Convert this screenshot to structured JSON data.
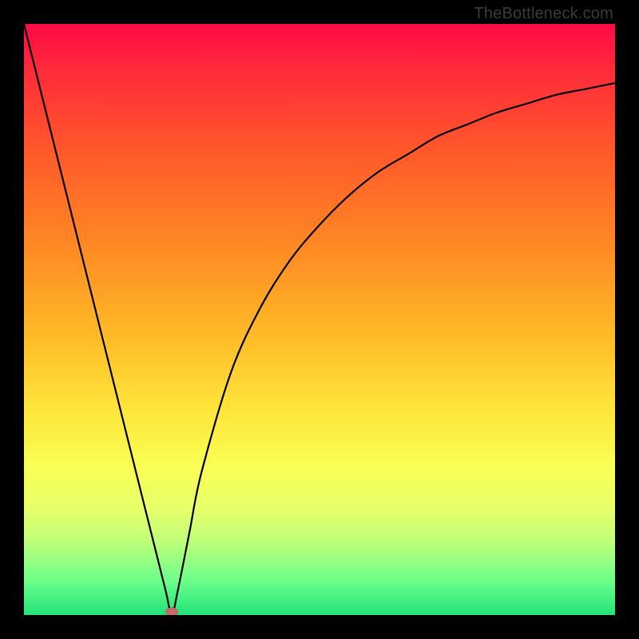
{
  "watermark": "TheBottleneck.com",
  "chart_data": {
    "type": "line",
    "title": "",
    "xlabel": "",
    "ylabel": "",
    "xlim": [
      0,
      100
    ],
    "ylim": [
      0,
      100
    ],
    "grid": false,
    "legend": false,
    "background_gradient": {
      "direction": "vertical",
      "stops": [
        {
          "y": 100,
          "color": "#ff0a46"
        },
        {
          "y": 75,
          "color": "#ff5a2a"
        },
        {
          "y": 50,
          "color": "#ffb827"
        },
        {
          "y": 30,
          "color": "#ffe43a"
        },
        {
          "y": 15,
          "color": "#e8ff6a"
        },
        {
          "y": 0,
          "color": "#22e37a"
        }
      ]
    },
    "series": [
      {
        "name": "curve",
        "x": [
          0,
          5,
          10,
          15,
          20,
          22,
          24,
          25,
          26,
          28,
          30,
          35,
          40,
          45,
          50,
          55,
          60,
          65,
          70,
          75,
          80,
          85,
          90,
          95,
          100
        ],
        "y": [
          100,
          80,
          60,
          40,
          20,
          12,
          4,
          0,
          4,
          14,
          24,
          41,
          52,
          60,
          66,
          71,
          75,
          78,
          81,
          83,
          85,
          86.5,
          88,
          89,
          90
        ]
      }
    ],
    "minimum_marker": {
      "x": 25,
      "y": 0,
      "color": "#c96a6a"
    }
  }
}
